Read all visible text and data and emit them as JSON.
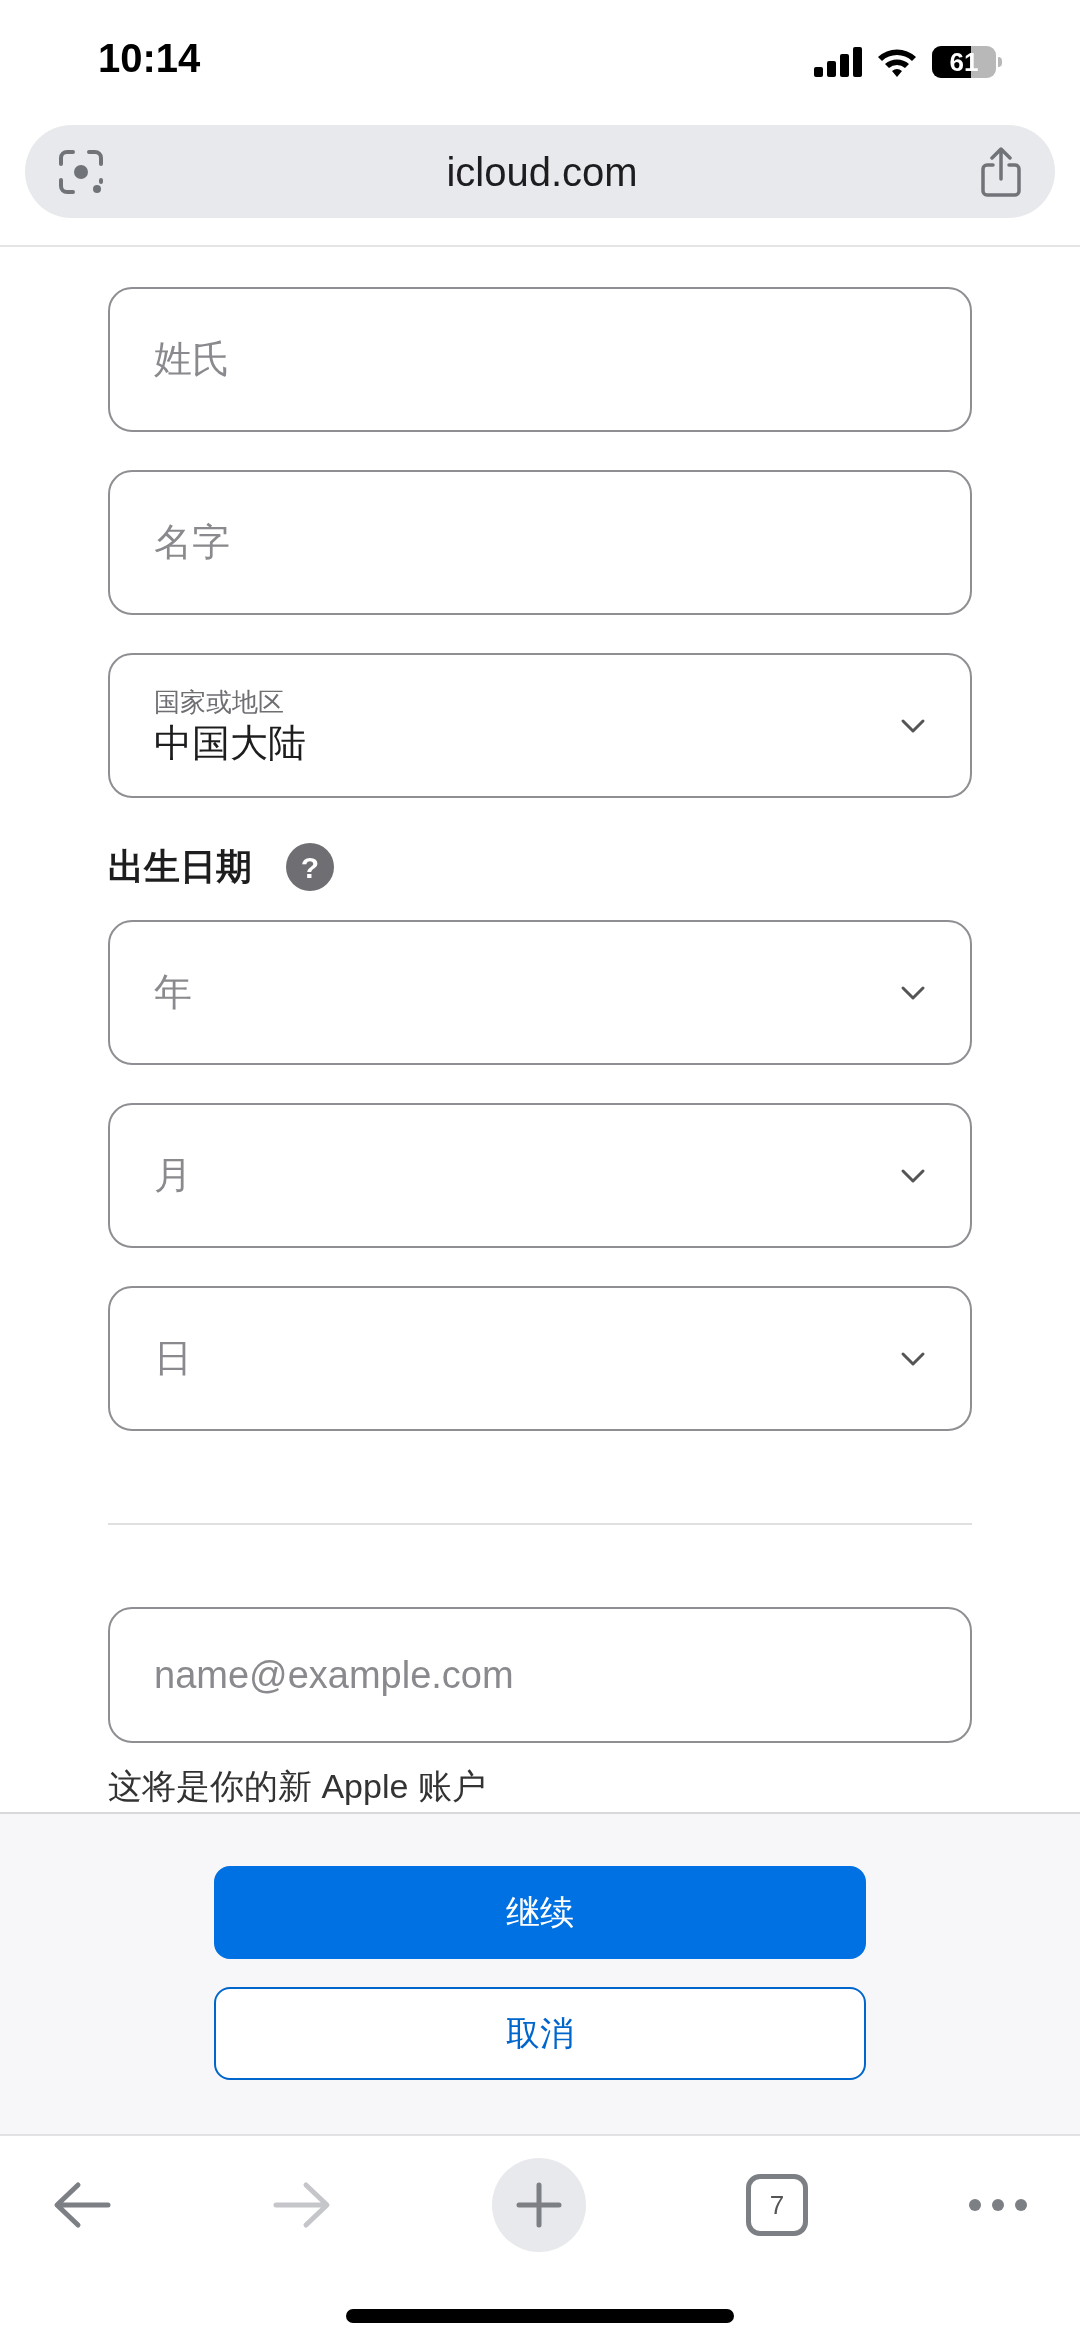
{
  "status_bar": {
    "time": "10:14",
    "battery": "61"
  },
  "address_bar": {
    "url": "icloud.com"
  },
  "form": {
    "fields": [
      {
        "kind": "text",
        "placeholder": "姓氏"
      },
      {
        "kind": "text",
        "placeholder": "名字"
      },
      {
        "kind": "select",
        "label": "国家或地区",
        "value": "中国大陆"
      }
    ],
    "birth_date": {
      "label": "出生日期",
      "help": "?",
      "fields": [
        {
          "kind": "select",
          "placeholder": "年"
        },
        {
          "kind": "select",
          "placeholder": "月"
        },
        {
          "kind": "select",
          "placeholder": "日"
        }
      ]
    },
    "email": {
      "placeholder": "name@example.com",
      "note": "这将是你的新 Apple 账户"
    }
  },
  "buttons": [
    {
      "kind": "primary",
      "label": "继续"
    },
    {
      "kind": "secondary",
      "label": "取消"
    }
  ],
  "toolbar": {
    "tabs_count": "7"
  }
}
